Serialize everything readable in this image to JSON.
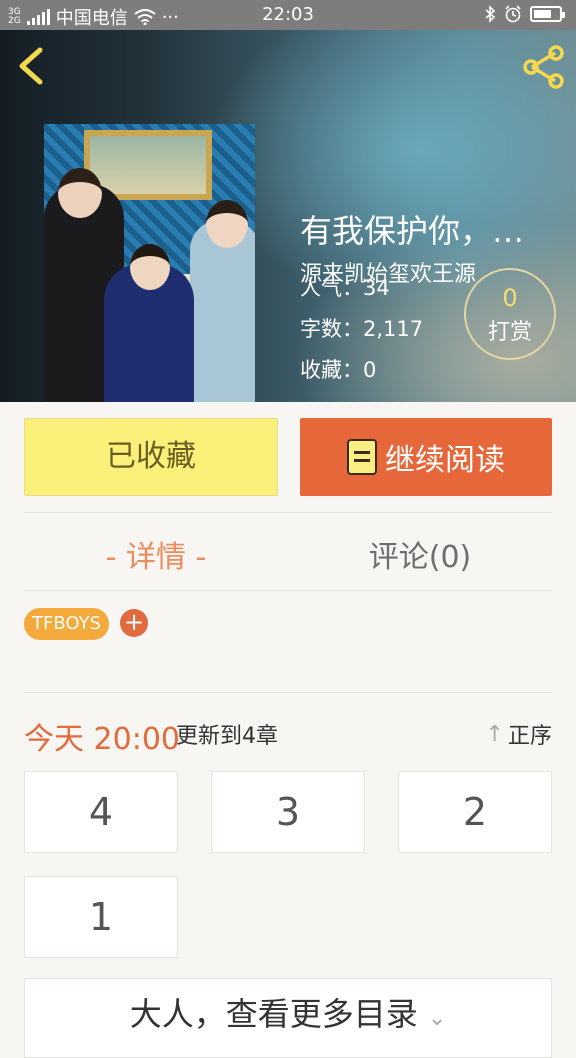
{
  "status_bar": {
    "network_top": "3G",
    "network_bottom": "2G",
    "carrier": "中国电信",
    "more": "···",
    "time": "22:03"
  },
  "header": {
    "back_icon": "chevron-left-icon",
    "share_icon": "share-icon"
  },
  "book": {
    "title": "有我保护你，…",
    "author": "源来凯始玺欢王源",
    "popularity_label": "人气：",
    "popularity": "34",
    "word_count_label": "字数：",
    "word_count": "2,117",
    "favorites_label": "收藏：",
    "favorites": "0",
    "tip_count": "0",
    "tip_label": "打赏"
  },
  "actions": {
    "collected_label": "已收藏",
    "continue_label": "继续阅读"
  },
  "tabs": {
    "detail": "- 详情 -",
    "comments": "评论(0)"
  },
  "tags": {
    "items": [
      "TFBOYS"
    ],
    "add": "+"
  },
  "update": {
    "time": "今天 20:00",
    "info": "更新到4章",
    "sort_label": "正序"
  },
  "chapters": [
    "4",
    "3",
    "2",
    "1"
  ],
  "more_catalog": "大人，查看更多目录",
  "colors": {
    "accent_orange": "#e6683a",
    "collected_yellow": "#fbf07a",
    "tag_orange": "#f4a93b"
  }
}
